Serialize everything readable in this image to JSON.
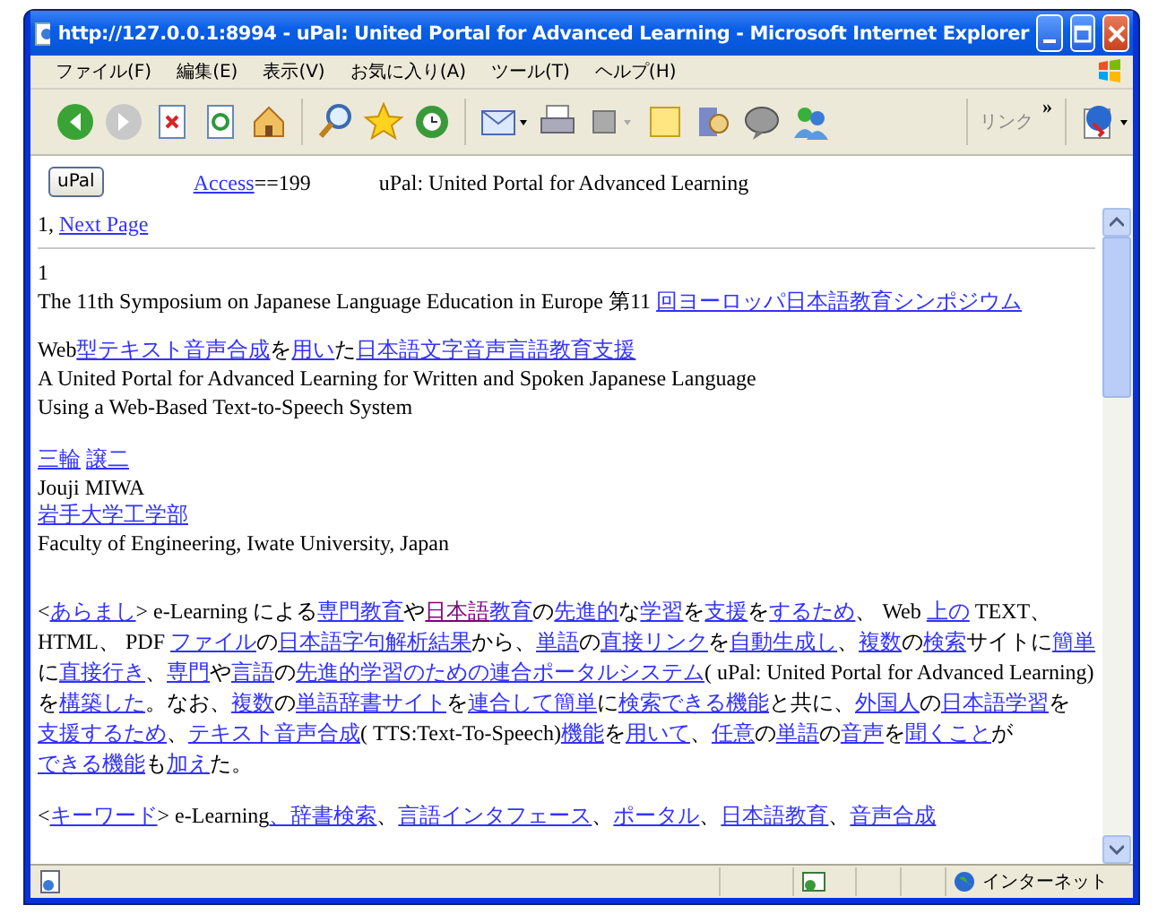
{
  "window": {
    "title": "http://127.0.0.1:8994 - uPal: United Portal for Advanced Learning - Microsoft Internet Explorer"
  },
  "menu": [
    "ファイル(F)",
    "編集(E)",
    "表示(V)",
    "お気に入り(A)",
    "ツール(T)",
    "ヘルプ(H)"
  ],
  "toolbar": {
    "links_label": "リンク",
    "links_chevron": "»"
  },
  "header": {
    "button": "uPal",
    "access_link": "Access",
    "access_value": "==199",
    "title": "uPal: United Portal for Advanced Learning"
  },
  "pager": {
    "page": "1,",
    "next_link": "Next Page"
  },
  "article": {
    "number": "1",
    "event": [
      {
        "kind": "text",
        "text": "The 11th Symposium on Japanese Language Education in Europe 第11 "
      },
      {
        "kind": "link",
        "text": "回ヨーロッパ日本語教育シンポジウム"
      }
    ],
    "title_ja": [
      {
        "kind": "text",
        "text": "Web"
      },
      {
        "kind": "link",
        "text": "型テキスト音声合成"
      },
      {
        "kind": "text",
        "text": "を"
      },
      {
        "kind": "link",
        "text": "用い"
      },
      {
        "kind": "text",
        "text": "た"
      },
      {
        "kind": "link",
        "text": "日本語文字音声言語教育支援"
      }
    ],
    "title_en": [
      "A United Portal for Advanced Learning for Written and Spoken Japanese Language",
      "Using a Web-Based Text-to-Speech System"
    ],
    "author_ja": [
      "三輪",
      "譲二"
    ],
    "author_en": "Jouji MIWA",
    "affiliation_ja": "岩手大学工学部",
    "affiliation_en": "Faculty of Engineering, Iwate University, Japan",
    "abstract": [
      {
        "kind": "text",
        "text": "<"
      },
      {
        "kind": "link",
        "text": "あらまし"
      },
      {
        "kind": "text",
        "text": "> e-Learning による"
      },
      {
        "kind": "link",
        "text": "専門教育"
      },
      {
        "kind": "text",
        "text": "や"
      },
      {
        "kind": "visited",
        "text": "日本語"
      },
      {
        "kind": "link",
        "text": "教育"
      },
      {
        "kind": "text",
        "text": "の"
      },
      {
        "kind": "link",
        "text": "先進的"
      },
      {
        "kind": "text",
        "text": "な"
      },
      {
        "kind": "link",
        "text": "学習"
      },
      {
        "kind": "text",
        "text": "を"
      },
      {
        "kind": "link",
        "text": "支援"
      },
      {
        "kind": "text",
        "text": "を"
      },
      {
        "kind": "link",
        "text": "するため"
      },
      {
        "kind": "text",
        "text": "、 Web "
      },
      {
        "kind": "link",
        "text": "上の"
      },
      {
        "kind": "text",
        "text": " TEXT、 HTML、 PDF "
      },
      {
        "kind": "link",
        "text": "ファイル"
      },
      {
        "kind": "text",
        "text": "の"
      },
      {
        "kind": "link",
        "text": "日本語字句解析結果"
      },
      {
        "kind": "text",
        "text": "から、"
      },
      {
        "kind": "link",
        "text": "単語"
      },
      {
        "kind": "text",
        "text": "の"
      },
      {
        "kind": "link",
        "text": "直接リンク"
      },
      {
        "kind": "text",
        "text": "を"
      },
      {
        "kind": "link",
        "text": "自動生成し"
      },
      {
        "kind": "text",
        "text": "、"
      },
      {
        "kind": "link",
        "text": "複数"
      },
      {
        "kind": "text",
        "text": "の"
      },
      {
        "kind": "link",
        "text": "検索"
      },
      {
        "kind": "text",
        "text": "サイトに"
      },
      {
        "kind": "link",
        "text": "簡単"
      },
      {
        "kind": "text",
        "text": "に"
      },
      {
        "kind": "link",
        "text": "直接行き"
      },
      {
        "kind": "text",
        "text": "、"
      },
      {
        "kind": "link",
        "text": "専門"
      },
      {
        "kind": "text",
        "text": "や"
      },
      {
        "kind": "link",
        "text": "言語"
      },
      {
        "kind": "text",
        "text": "の"
      },
      {
        "kind": "link",
        "text": "先進的学習のための"
      },
      {
        "kind": "link",
        "text": "連合ポータルシステム"
      },
      {
        "kind": "text",
        "text": "( uPal: United Portal for Advanced Learning)を"
      },
      {
        "kind": "link",
        "text": "構築した"
      },
      {
        "kind": "text",
        "text": "。なお、"
      },
      {
        "kind": "link",
        "text": "複数"
      },
      {
        "kind": "text",
        "text": "の"
      },
      {
        "kind": "link",
        "text": "単語辞書サイト"
      },
      {
        "kind": "text",
        "text": "を"
      },
      {
        "kind": "link",
        "text": "連合して"
      },
      {
        "kind": "link",
        "text": "簡単"
      },
      {
        "kind": "text",
        "text": "に"
      },
      {
        "kind": "link",
        "text": "検索できる機能"
      },
      {
        "kind": "text",
        "text": "と共に、"
      },
      {
        "kind": "link",
        "text": "外国人"
      },
      {
        "kind": "text",
        "text": "の"
      },
      {
        "kind": "link",
        "text": "日本語学習"
      },
      {
        "kind": "text",
        "text": "を"
      },
      {
        "kind": "link",
        "text": "支援するため"
      },
      {
        "kind": "text",
        "text": "、"
      },
      {
        "kind": "link",
        "text": "テキスト音声合成"
      },
      {
        "kind": "text",
        "text": "( TTS:Text-To-Speech)"
      },
      {
        "kind": "link",
        "text": "機能"
      },
      {
        "kind": "text",
        "text": "を"
      },
      {
        "kind": "link",
        "text": "用いて"
      },
      {
        "kind": "text",
        "text": "、"
      },
      {
        "kind": "link",
        "text": "任意"
      },
      {
        "kind": "text",
        "text": "の"
      },
      {
        "kind": "link",
        "text": "単語"
      },
      {
        "kind": "text",
        "text": "の"
      },
      {
        "kind": "link",
        "text": "音声"
      },
      {
        "kind": "text",
        "text": "を"
      },
      {
        "kind": "link",
        "text": "聞くこと"
      },
      {
        "kind": "text",
        "text": "が"
      },
      {
        "kind": "link",
        "text": "できる機能"
      },
      {
        "kind": "text",
        "text": "も"
      },
      {
        "kind": "link",
        "text": "加え"
      },
      {
        "kind": "text",
        "text": "た。"
      }
    ],
    "keywords": [
      {
        "kind": "text",
        "text": "<"
      },
      {
        "kind": "link",
        "text": "キーワード"
      },
      {
        "kind": "text",
        "text": "> e-Learning"
      },
      {
        "kind": "link",
        "text": "、辞書検索"
      },
      {
        "kind": "text",
        "text": "、"
      },
      {
        "kind": "link",
        "text": "言語インタフェース"
      },
      {
        "kind": "text",
        "text": "、"
      },
      {
        "kind": "link",
        "text": "ポータル"
      },
      {
        "kind": "text",
        "text": "、"
      },
      {
        "kind": "link",
        "text": "日本語教育"
      },
      {
        "kind": "text",
        "text": "、"
      },
      {
        "kind": "link",
        "text": "音声合成"
      }
    ]
  },
  "status_bar": {
    "zone": "インターネット"
  }
}
